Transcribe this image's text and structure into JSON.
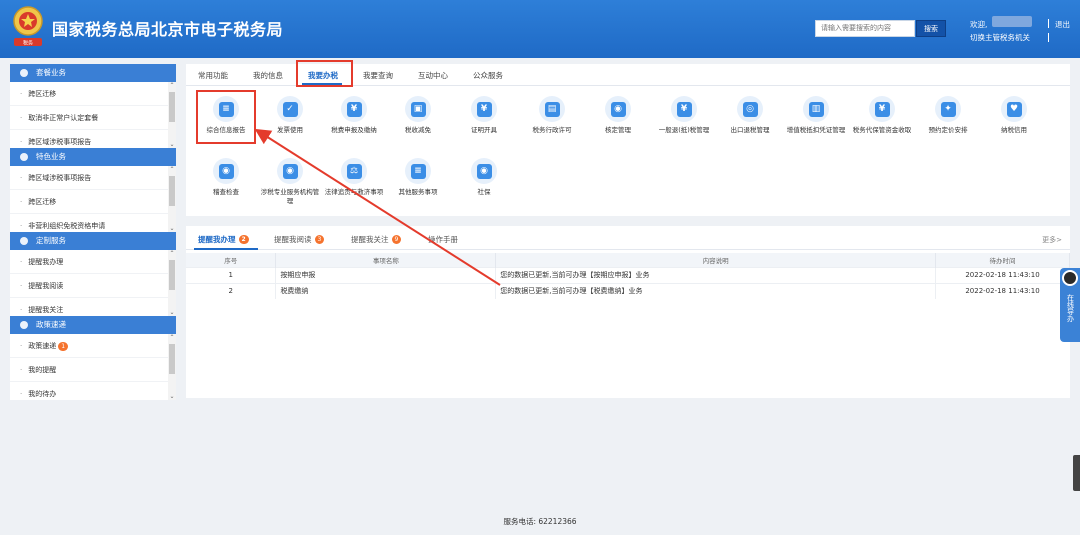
{
  "header": {
    "title": "国家税务总局北京市电子税务局",
    "search_placeholder": "请输入需要搜索的内容",
    "search_button": "搜索",
    "welcome": "欢迎,",
    "switch_user": "切换主管税务机关",
    "logout": "退出",
    "logo_text": "税务"
  },
  "sidebar": {
    "groups": [
      {
        "title": "套餐业务",
        "items": [
          "跨区迁移",
          "取消非正常户认定套餐",
          "跨区域涉税事项报告"
        ]
      },
      {
        "title": "特色业务",
        "items": [
          "跨区域涉税事项报告",
          "跨区迁移",
          "非营利组织免税资格申请"
        ]
      },
      {
        "title": "定制服务",
        "items": [
          "提醒我办理",
          "提醒我阅读",
          "提醒我关注"
        ]
      },
      {
        "title": "政策速递",
        "items": [
          "政策速递",
          "我的提醒",
          "我的待办"
        ],
        "badge": "1"
      }
    ]
  },
  "main": {
    "tabs": [
      "常用功能",
      "我的信息",
      "我要办税",
      "我要查询",
      "互动中心",
      "公众服务"
    ],
    "active_tab": 2,
    "functions": [
      {
        "label": "综合信息报告",
        "icon": "report-icon",
        "glyph": "≡"
      },
      {
        "label": "发票使用",
        "icon": "invoice-icon",
        "glyph": "✓"
      },
      {
        "label": "税费申报及缴纳",
        "icon": "tax-declare-icon",
        "glyph": "¥"
      },
      {
        "label": "税收减免",
        "icon": "tax-reduce-icon",
        "glyph": "▣"
      },
      {
        "label": "证明开具",
        "icon": "certificate-icon",
        "glyph": "¥"
      },
      {
        "label": "税务行政许可",
        "icon": "permit-icon",
        "glyph": "▤"
      },
      {
        "label": "核定管理",
        "icon": "approval-icon",
        "glyph": "◉"
      },
      {
        "label": "一般退(抵)税管理",
        "icon": "refund-icon",
        "glyph": "¥"
      },
      {
        "label": "出口退税管理",
        "icon": "export-refund-icon",
        "glyph": "◎"
      },
      {
        "label": "增值税抵扣凭证管理",
        "icon": "vat-voucher-icon",
        "glyph": "▥"
      },
      {
        "label": "税务代保管资金收取",
        "icon": "custody-fund-icon",
        "glyph": "¥"
      },
      {
        "label": "预约定价安排",
        "icon": "pricing-icon",
        "glyph": "✦"
      },
      {
        "label": "纳税信用",
        "icon": "credit-icon",
        "glyph": "♥"
      },
      {
        "label": "稽查检查",
        "icon": "inspection-icon",
        "glyph": "◉"
      },
      {
        "label": "涉税专业服务机构管理",
        "icon": "agency-icon",
        "glyph": "◉"
      },
      {
        "label": "法律追责与救济事项",
        "icon": "legal-icon",
        "glyph": "⚖"
      },
      {
        "label": "其他服务事项",
        "icon": "other-service-icon",
        "glyph": "≡"
      },
      {
        "label": "社保",
        "icon": "social-insurance-icon",
        "glyph": "◉"
      }
    ]
  },
  "reminders": {
    "tabs": [
      {
        "label": "提醒我办理",
        "count": "2"
      },
      {
        "label": "提醒我阅读",
        "count": "3"
      },
      {
        "label": "提醒我关注",
        "count": "9"
      },
      {
        "label": "操作手册",
        "count": ""
      }
    ],
    "more": "更多>",
    "columns": [
      "序号",
      "事项名称",
      "内容说明",
      "待办时间"
    ],
    "rows": [
      {
        "no": "1",
        "name": "按期应申报",
        "desc": "您的数据已更新,当前可办理【按期应申报】业务",
        "time": "2022-02-18 11:43:10"
      },
      {
        "no": "2",
        "name": "税费缴纳",
        "desc": "您的数据已更新,当前可办理【税费缴纳】业务",
        "time": "2022-02-18 11:43:10"
      }
    ]
  },
  "footer": {
    "phone": "服务电话: 62212366"
  },
  "float_service": {
    "label": "在线导办"
  },
  "colors": {
    "header": "#1f6ac6",
    "accent": "#3a7fd5",
    "highlight": "#e43b2c",
    "badge": "#f5732e"
  }
}
